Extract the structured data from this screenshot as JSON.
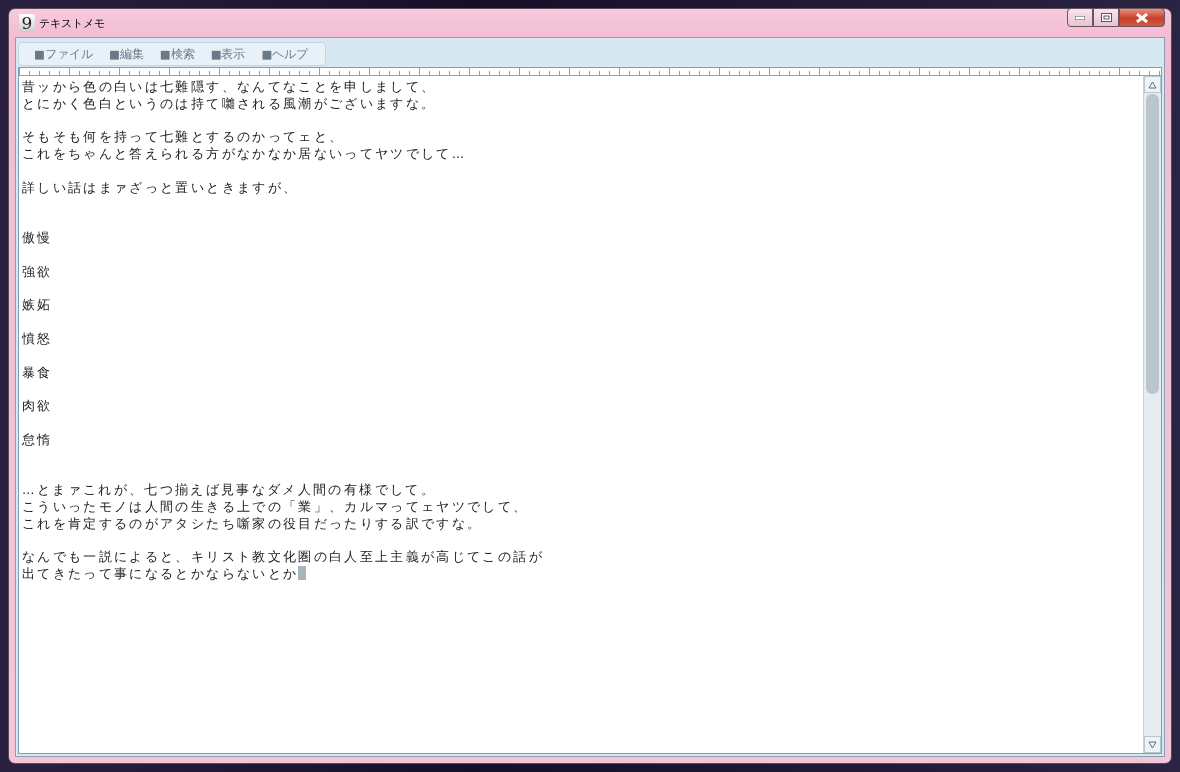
{
  "window": {
    "icon_label": "9",
    "title": "テキストメモ"
  },
  "menu": [
    "■ファイル",
    "■編集",
    "■検索",
    "■表示",
    "■ヘルプ"
  ],
  "document": [
    {
      "kind": "line",
      "text": "昔ッから色の白いは七難隠す、なんてなことを申しまして、"
    },
    {
      "kind": "line",
      "text": "とにかく色白というのは持て囃される風潮がございますな。"
    },
    {
      "kind": "blank"
    },
    {
      "kind": "line",
      "text": "そもそも何を持って七難とするのかってェと、"
    },
    {
      "kind": "line",
      "text": "これをちゃんと答えられる方がなかなか居ないってヤツでして…"
    },
    {
      "kind": "blank"
    },
    {
      "kind": "line",
      "text": "詳しい話はまァざっと置いときますが、"
    },
    {
      "kind": "blank"
    },
    {
      "kind": "blank"
    },
    {
      "kind": "line",
      "text": "傲慢"
    },
    {
      "kind": "blank"
    },
    {
      "kind": "line",
      "text": "強欲"
    },
    {
      "kind": "blank"
    },
    {
      "kind": "line",
      "text": "嫉妬"
    },
    {
      "kind": "blank"
    },
    {
      "kind": "line",
      "text": "憤怒"
    },
    {
      "kind": "blank"
    },
    {
      "kind": "line",
      "text": "暴食"
    },
    {
      "kind": "blank"
    },
    {
      "kind": "line",
      "text": "肉欲"
    },
    {
      "kind": "blank"
    },
    {
      "kind": "line",
      "text": "怠惰"
    },
    {
      "kind": "blank"
    },
    {
      "kind": "blank"
    },
    {
      "kind": "line",
      "text": "…とまァこれが、七つ揃えば見事なダメ人間の有様でして。"
    },
    {
      "kind": "line",
      "text": "こういったモノは人間の生きる上での「業」、カルマってェヤツでして、"
    },
    {
      "kind": "line",
      "text": "これを肯定するのがアタシたち噺家の役目だったりする訳ですな。"
    },
    {
      "kind": "blank"
    },
    {
      "kind": "line",
      "text": "なんでも一説によると、キリスト教文化圏の白人至上主義が高じてこの話が"
    },
    {
      "kind": "line",
      "text": "出てきたって事になるとかならないとか",
      "caret": true
    }
  ]
}
